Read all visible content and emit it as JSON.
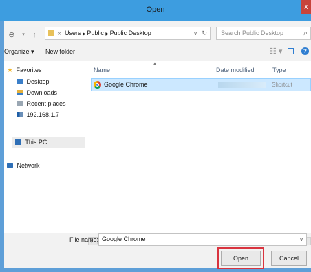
{
  "window": {
    "title": "Open",
    "close_glyph": "x"
  },
  "nav": {
    "back": "⊖",
    "forward": "→",
    "up": "↑",
    "refresh": "↻"
  },
  "address": {
    "overflow": "«",
    "crumbs": [
      "Users",
      "Public",
      "Public Desktop"
    ],
    "dropdown": "⌄"
  },
  "search": {
    "placeholder": "Search Public Desktop",
    "icon": "⌕"
  },
  "toolbar": {
    "organize": "Organize ▾",
    "new_folder": "New folder"
  },
  "sidebar": {
    "items": [
      {
        "label": "Favorites",
        "icon": "star-icon"
      },
      {
        "label": "Desktop",
        "icon": "desktop-icon"
      },
      {
        "label": "Downloads",
        "icon": "downloads-icon"
      },
      {
        "label": "Recent places",
        "icon": "recent-places-icon"
      },
      {
        "label": "192.168.1.7",
        "icon": "network-drive-icon"
      },
      {
        "label": "This PC",
        "icon": "computer-icon"
      },
      {
        "label": "Network",
        "icon": "network-icon"
      }
    ]
  },
  "columns": {
    "name": "Name",
    "date_modified": "Date modified",
    "type": "Type"
  },
  "files": [
    {
      "name": "Google Chrome",
      "type": "Shortcut",
      "icon": "chrome-icon"
    }
  ],
  "filename": {
    "label": "File name:",
    "value": "Google Chrome"
  },
  "buttons": {
    "open": "Open",
    "cancel": "Cancel"
  },
  "colors": {
    "titlebar": "#3d9de0",
    "selection": "#cce8ff",
    "highlight": "#d9343f"
  }
}
